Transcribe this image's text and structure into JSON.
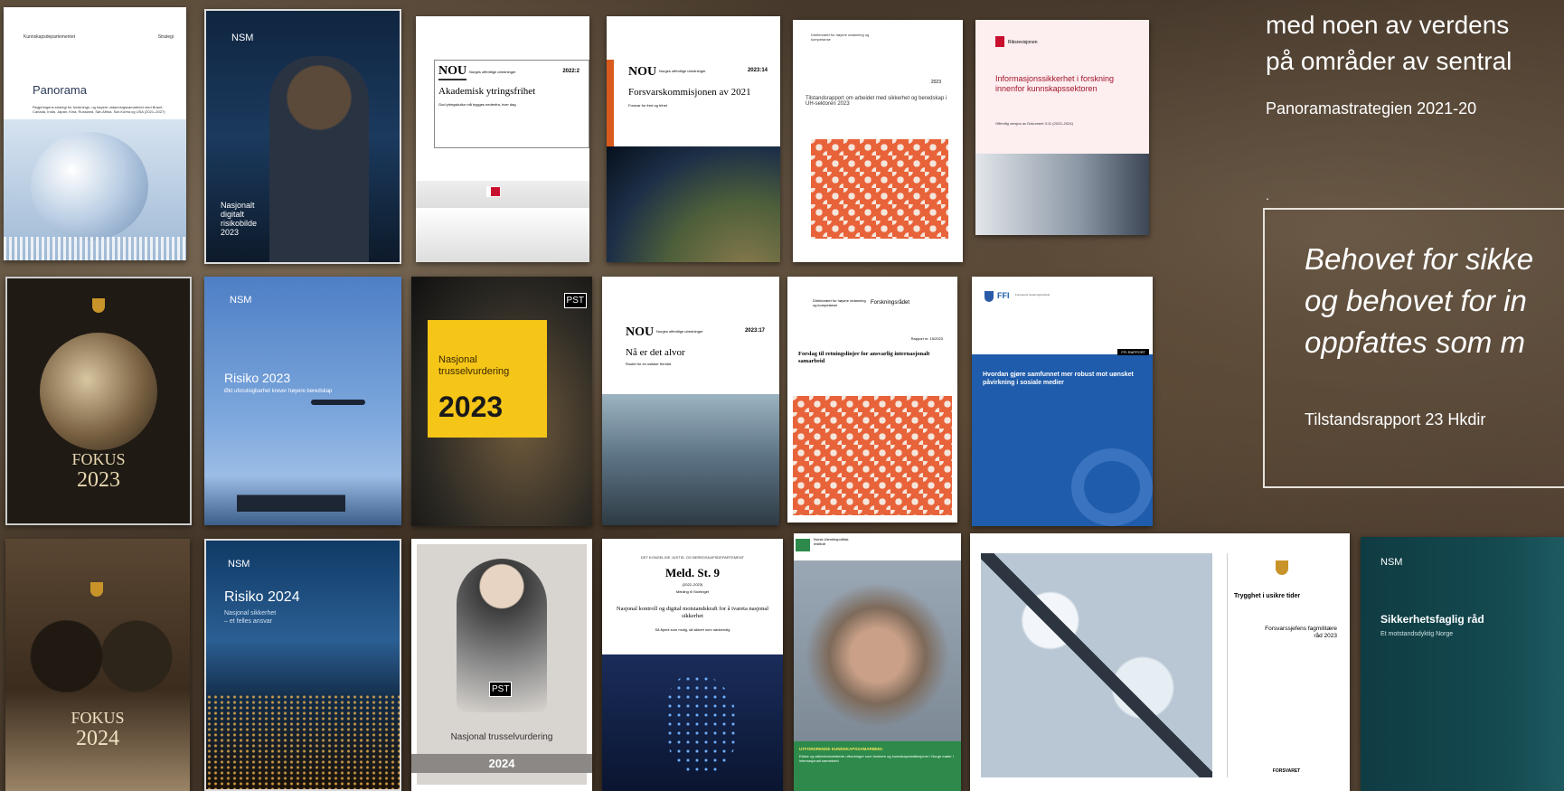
{
  "right_panel": {
    "line1": "med noen av verdens",
    "line2": "på områder av sentral",
    "source1": "Panoramastrategien 2021-20",
    "dot": ".",
    "quote_line1": "Behovet for sikke",
    "quote_line2": "og behovet for in",
    "quote_line3": "oppfattes som m",
    "source2": "Tilstandsrapport 23 Hkdir"
  },
  "covers": {
    "c1": {
      "dept": "Kunnskapsdepartementet",
      "tag": "Strategi",
      "title": "Panorama",
      "subtitle": "Regjeringens strategi for forsknings- og høyere utdanningssamarbeid med Brasil, Canada, India, Japan, Kina, Russland, Sør-Afrika, Sør-Korea og USA (2021–2027)"
    },
    "c2": {
      "org": "NSM",
      "title": "Nasjonalt\ndigitalt\nrisikobilde\n2023"
    },
    "c3": {
      "nou": "NOU",
      "series": "Norges offentlige utredninger",
      "num": "2022:2",
      "title": "Akademisk ytringsfrihet",
      "sub": "God ytringskultur må bygges nedenfra, hver dag"
    },
    "c4": {
      "nou": "NOU",
      "series": "Norges offentlige utredninger",
      "num": "2023:14",
      "title": "Forsvarskommisjonen av 2021",
      "sub": "Forsvar for fred og frihet"
    },
    "c5": {
      "org": "Direktoratet for høyere utdanning og kompetanse",
      "year": "2023",
      "title": "Tilstandsrapport om arbeidet med sikkerhet og beredskap i UH-sektoren 2023"
    },
    "c6": {
      "org": "Riksrevisjonen",
      "title": "Informasjonssikkerhet i forskning innenfor kunnskapssektoren",
      "sub": "Offentlig versjon av Dokument 3:11 (2023–2024)"
    },
    "c7": {
      "title": "FOKUS",
      "year": "2023"
    },
    "c8": {
      "org": "NSM",
      "title": "Risiko 2023",
      "sub": "Økt uforutsigbarhet krever høyere beredskap"
    },
    "c9": {
      "badge": "PST",
      "title": "Nasjonal trusselvurdering",
      "year": "2023"
    },
    "c10": {
      "nou": "NOU",
      "series": "Norges offentlige utredninger",
      "num": "2023:17",
      "title": "Nå er det alvor",
      "sub": "Rustet for en usikker fremtid"
    },
    "c11": {
      "org": "Direktoratet for høyere utdanning og kompetanse",
      "org2": "Forskningsrådet",
      "report": "Rapport nr. 15/2023",
      "title": "Forslag til retningslinjer for ansvarlig internasjonalt samarbeid"
    },
    "c12": {
      "org": "FFI",
      "orgfull": "Forsvarets forskningsinstitutt",
      "label": "FFI-RAPPORT",
      "title": "Hvordan gjøre samfunnet mer robust mot uønsket påvirkning i sosiale medier"
    },
    "c13": {
      "title": "FOKUS",
      "year": "2024"
    },
    "c14": {
      "org": "NSM",
      "title": "Risiko 2024",
      "sub": "Nasjonal sikkerhet\n– et felles ansvar"
    },
    "c15": {
      "badge": "PST",
      "title": "Nasjonal trusselvurdering",
      "year": "2024"
    },
    "c16": {
      "ministry": "DET KONGELIGE JUSTIS- OG BEREDSKAPSDEPARTEMENT",
      "title": "Meld. St. 9",
      "years": "(2022–2023)",
      "note": "Melding til Stortinget",
      "main": "Nasjonal kontroll og digital motstandskraft for å ivareta nasjonal sikkerhet",
      "tagline": "Så åpent som mulig, så sikkert som nødvendig"
    },
    "c17": {
      "org": "Norsk Utenrikspolitisk Institutt",
      "title": "UTFORDRENDE KUNNSKAPSSAMARBEID:",
      "sub": "Etiske og sikkerhetsrelaterte utfordringer som forskere og kunnskapsinstitusjoner i Norge møter i internasjonalt samarbeid"
    },
    "c18": {
      "title": "Trygghet i usikre tider",
      "sub": "Forsvarssjefens fagmilitære råd 2023",
      "footer": "FORSVARET"
    },
    "c19": {
      "org": "NSM",
      "title": "Sikkerhetsfaglig råd",
      "sub": "Et motstandsdyktig Norge"
    }
  }
}
